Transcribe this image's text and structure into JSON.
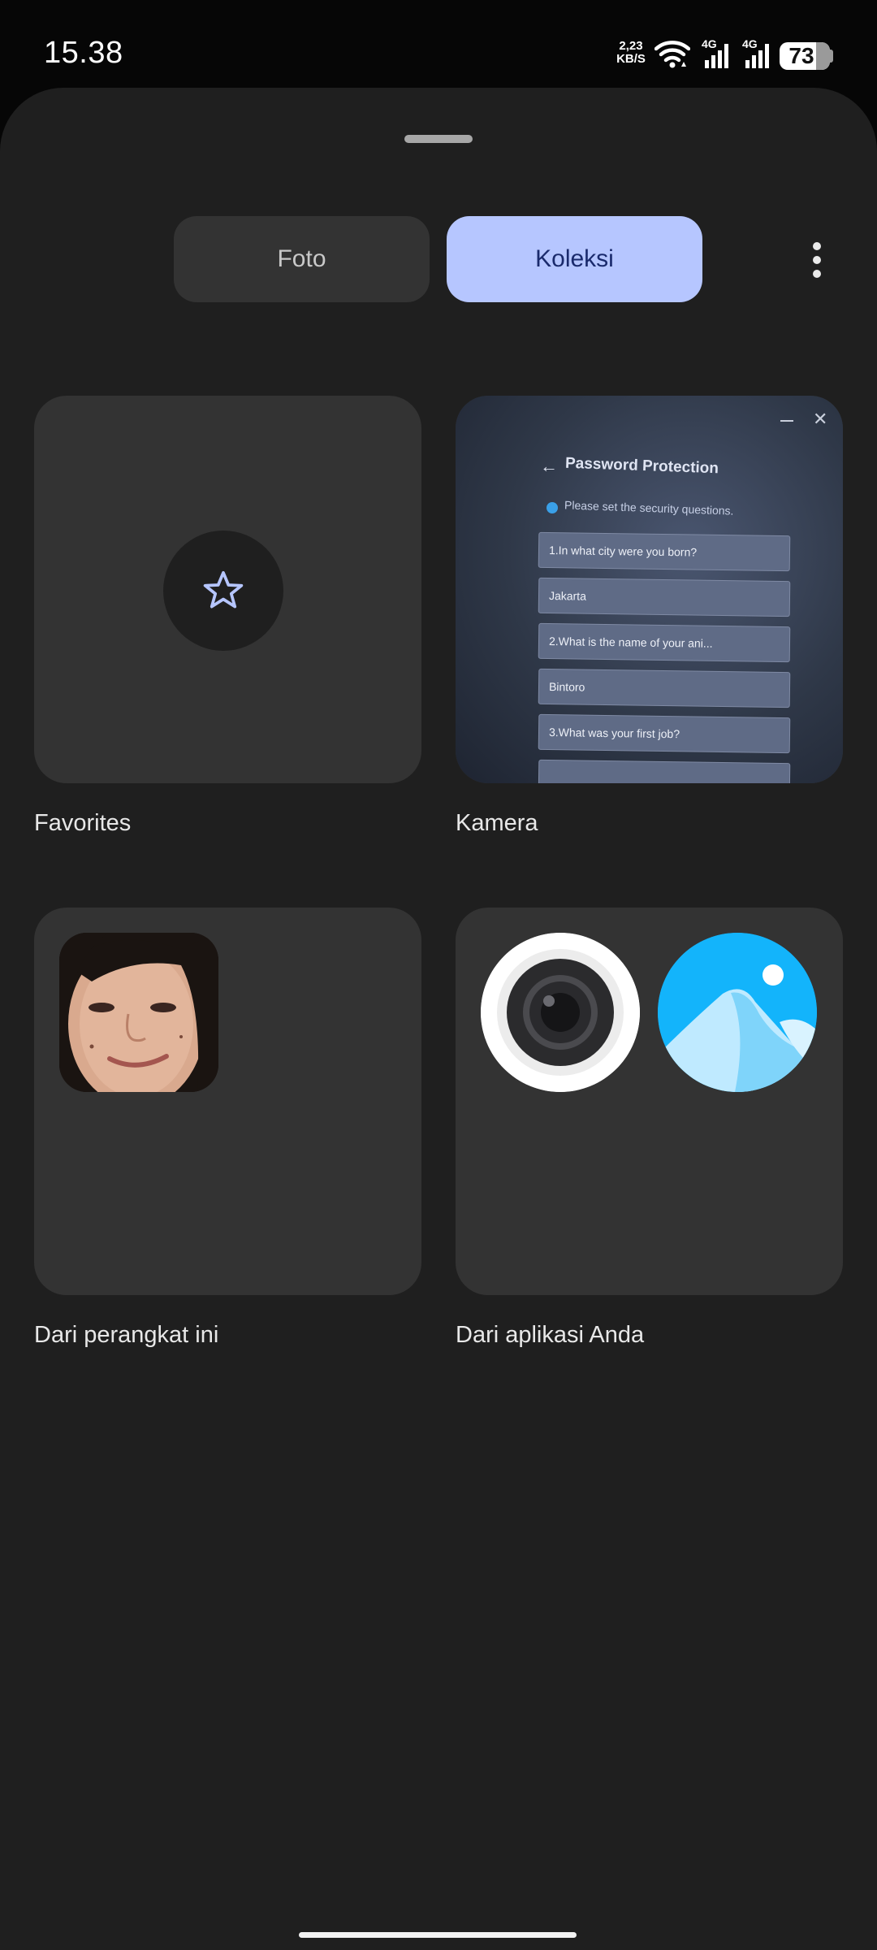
{
  "status_bar": {
    "time": "15.38",
    "net_speed_value": "2,23",
    "net_speed_unit": "KB/S",
    "signal_1_label": "4G",
    "signal_2_label": "4G",
    "battery_level": "73"
  },
  "tabs": {
    "foto_label": "Foto",
    "koleksi_label": "Koleksi",
    "active": "Koleksi"
  },
  "albums": [
    {
      "label": "Favorites",
      "icon": "star-icon"
    },
    {
      "label": "Kamera"
    },
    {
      "label": "Dari perangkat ini"
    },
    {
      "label": "Dari aplikasi Anda",
      "icons": [
        "camera-app-icon",
        "gallery-app-icon"
      ]
    }
  ],
  "kamera_thumb": {
    "title": "Password Protection",
    "info": "Please set the security questions.",
    "q1": "1.In what city were you born?",
    "a1": "Jakarta",
    "q2": "2.What is the name of your ani...",
    "a2": "Bintoro",
    "q3": "3.What was your first job?"
  },
  "colors": {
    "background": "#1f1f1f",
    "card": "#333333",
    "accent": "#b6c6ff",
    "accent_text": "#1a2a6c"
  }
}
